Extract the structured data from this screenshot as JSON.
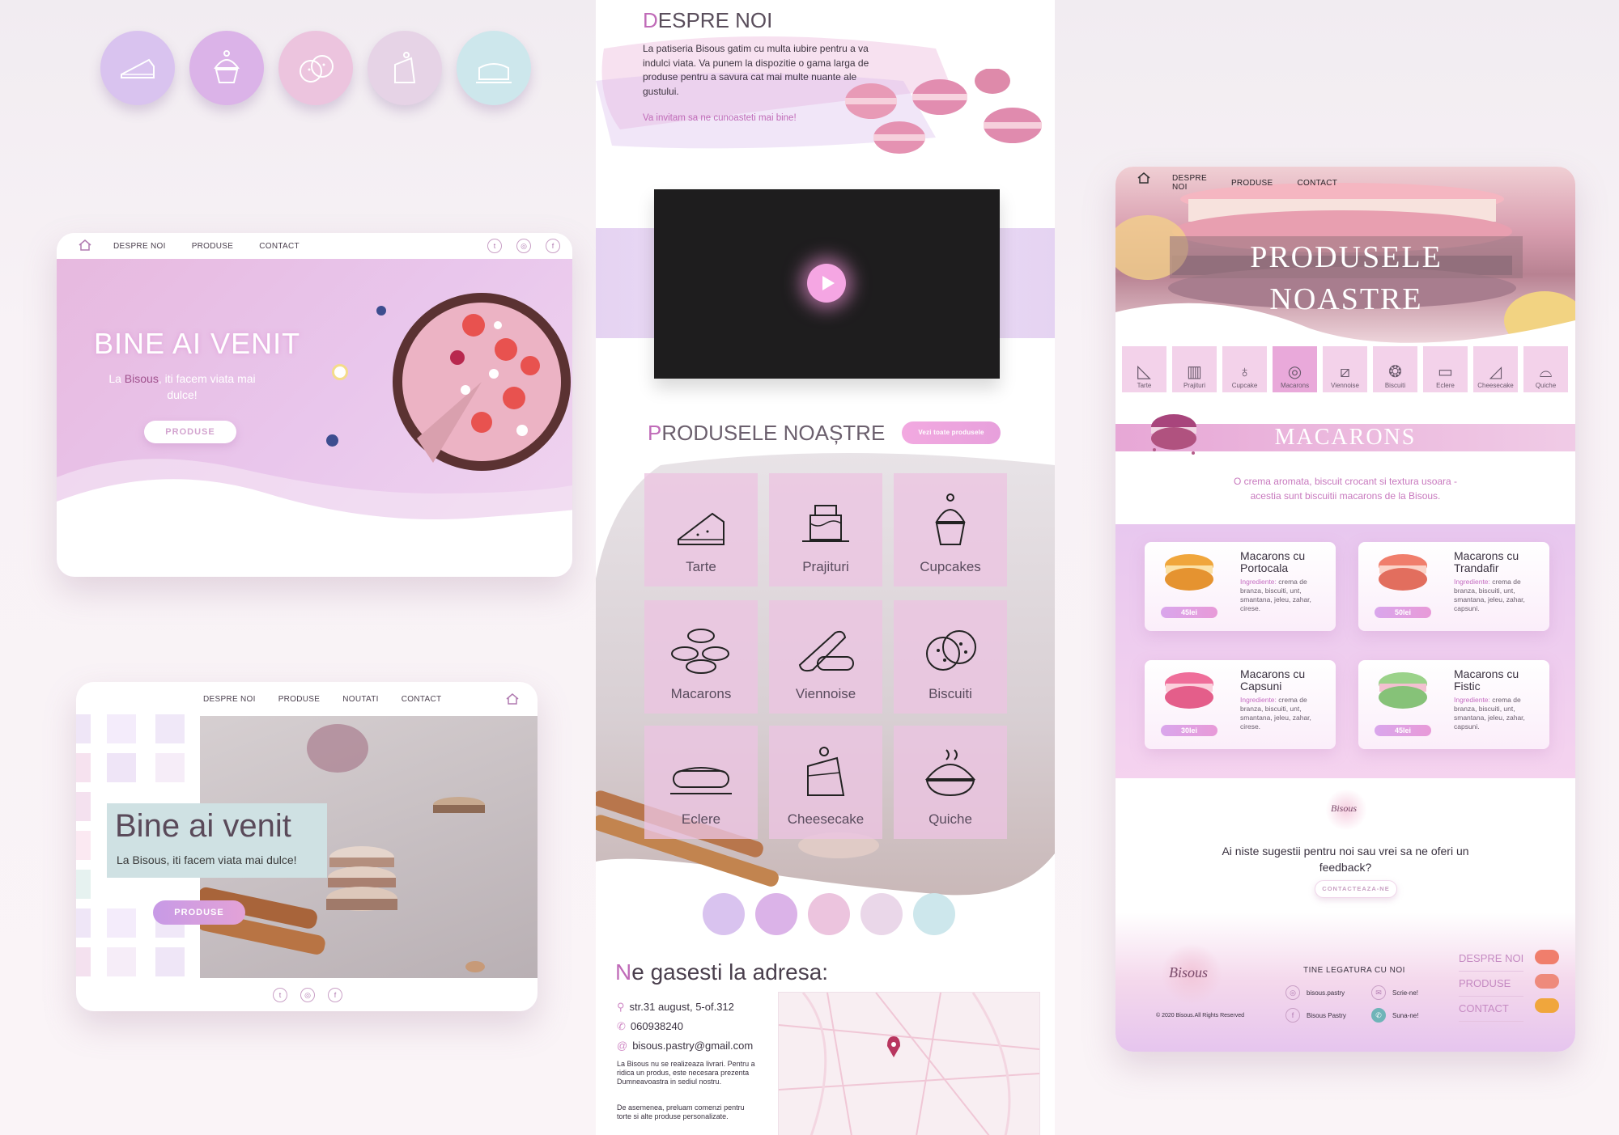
{
  "icon_circles": [
    {
      "icon": "pie-slice-icon",
      "color": "#d9c3ef"
    },
    {
      "icon": "cupcake-icon",
      "color": "#dbb3e8"
    },
    {
      "icon": "cookie-icon",
      "color": "#ecc4de"
    },
    {
      "icon": "cake-slice-icon",
      "color": "#e6d3e6"
    },
    {
      "icon": "cake-icon",
      "color": "#cde7ec"
    }
  ],
  "screen1": {
    "nav": [
      "DESPRE NOI",
      "PRODUSE",
      "CONTACT"
    ],
    "hero_title": "BINE AI VENIT",
    "hero_sub_pre": "La ",
    "hero_sub_brand": "Bisous",
    "hero_sub_post": ", iti facem viata mai dulce!",
    "button": "PRODUSE"
  },
  "screen2": {
    "nav": [
      "DESPRE NOI",
      "PRODUSE",
      "NOUTATI",
      "CONTACT"
    ],
    "hero_title": "Bine ai venit",
    "hero_sub": "La Bisous, iti facem viata mai dulce!",
    "button": "PRODUSE"
  },
  "center": {
    "about_first": "D",
    "about_rest": "ESPRE NOI",
    "about_text": "La patiseria Bisous gatim cu multa iubire pentru a va indulci viata. Va punem la dispozitie o gama larga de produse pentru a savura cat mai multe nuante ale gustului.",
    "about_invite": "Va invitam sa ne cunoasteti mai bine!",
    "products_first": "P",
    "products_rest": "RODUSELE NOAȘTRE",
    "see_all": "Vezi toate produsele",
    "tiles": [
      "Tarte",
      "Prajituri",
      "Cupcakes",
      "Macarons",
      "Viennoise",
      "Biscuiti",
      "Eclere",
      "Cheesecake",
      "Quiche"
    ],
    "address_first": "N",
    "address_rest": "e gasesti la adresa:",
    "street": "str.31 august, 5-of.312",
    "phone": "060938240",
    "email": "bisous.pastry@gmail.com",
    "note1": "La Bisous nu se realizeaza livrari. Pentru a ridica un produs, este necesara prezenta Dumneavoastra in sediul nostru.",
    "note2": "De asemenea, preluam comenzi pentru torte si alte produse personalizate."
  },
  "right": {
    "nav": [
      "DESPRE NOI",
      "PRODUSE",
      "CONTACT"
    ],
    "hero_title": "PRODUSELE NOASTRE",
    "categories": [
      "Tarte",
      "Prajituri",
      "Cupcake",
      "Macarons",
      "Viennoise",
      "Biscuiti",
      "Eclere",
      "Cheesecake",
      "Quiche"
    ],
    "section_title": "MACARONS",
    "section_desc": "O crema aromata, biscuit crocant si textura usoara - acestia sunt biscuitii macarons de la Bisous.",
    "products": [
      {
        "name": "Macarons cu Portocala",
        "ing_label": "Ingrediente:",
        "ing": " crema de branza, biscuiti, unt, smantana, jeleu, zahar, cirese.",
        "price": "45lei",
        "color": "#f0a63c"
      },
      {
        "name": "Macarons cu Trandafir",
        "ing_label": "Ingrediente:",
        "ing": " crema de branza, biscuiti, unt, smantana, jeleu, zahar, capsuni.",
        "price": "50lei",
        "color": "#f07e6c"
      },
      {
        "name": "Macarons cu Capsuni",
        "ing_label": "Ingrediente:",
        "ing": " crema de branza, biscuiti, unt, smantana, jeleu, zahar, cirese.",
        "price": "30lei",
        "color": "#ef6e9a"
      },
      {
        "name": "Macarons cu Fistic",
        "ing_label": "Ingrediente:",
        "ing": " crema de branza, biscuiti, unt, smantana, jeleu, zahar, capsuni.",
        "price": "45lei",
        "color": "#9bd28a"
      }
    ],
    "feedback_text": "Ai niste sugestii pentru noi sau vrei sa ne oferi un feedback?",
    "feedback_button": "CONTACTEAZA-NE",
    "footer_copyright": "© 2020 Bisous.All Rights Reserved",
    "footer_title": "TINE LEGATURA CU NOI",
    "footer_links": [
      "bisous.pastry",
      "Scrie-ne!",
      "Bisous Pastry",
      "Suna-ne!"
    ],
    "footer_nav": [
      "DESPRE NOI",
      "PRODUSE",
      "CONTACT"
    ],
    "logo_text": "Bisous"
  }
}
